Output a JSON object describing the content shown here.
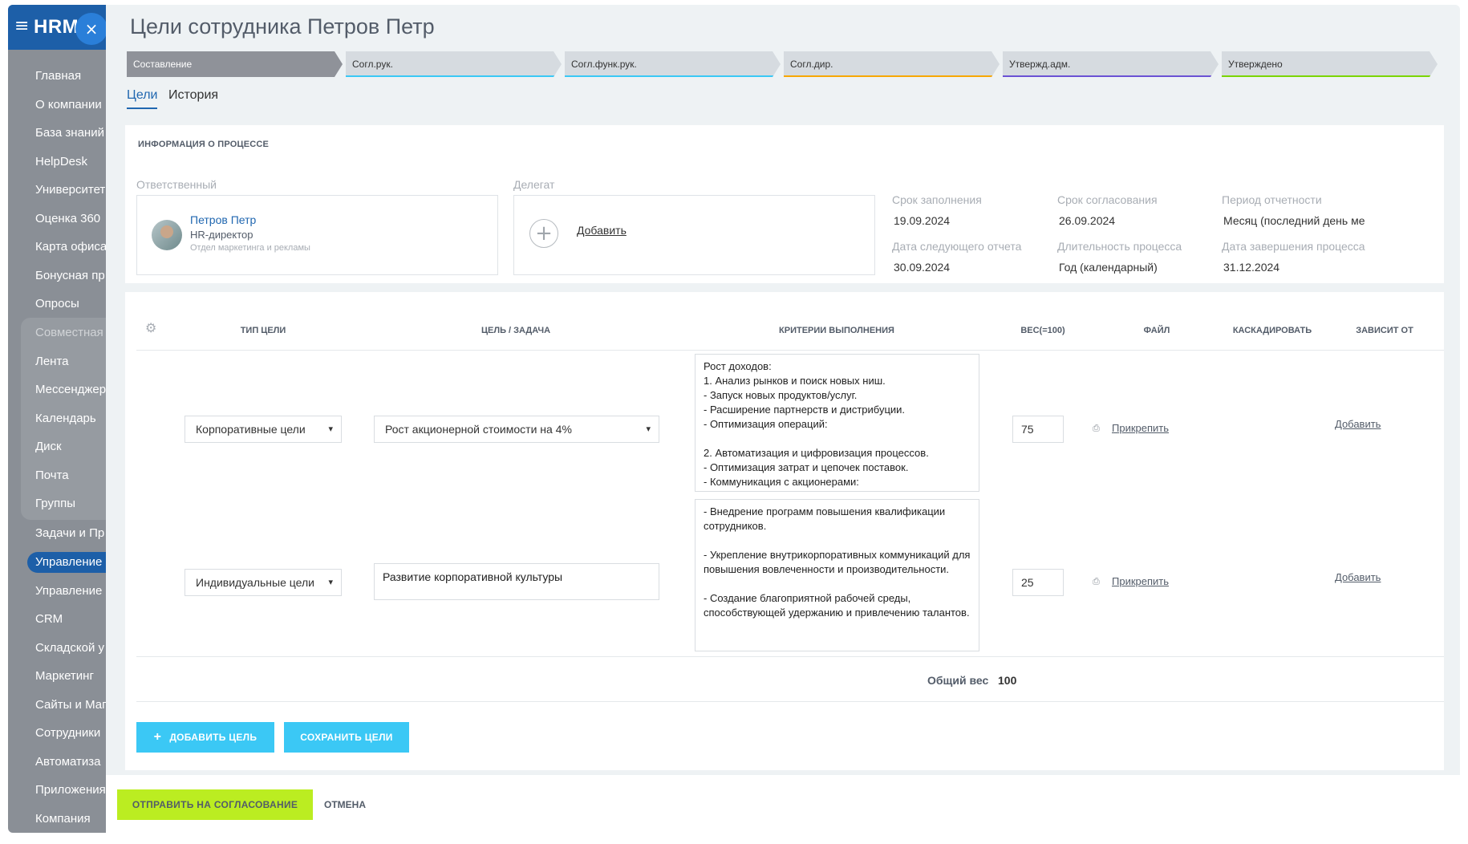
{
  "sidebar": {
    "logo": "HRM",
    "burger_icon": "≡",
    "close_icon": "×",
    "items": [
      "Главная",
      "О компании",
      "База знаний",
      "HelpDesk",
      "Университет",
      "Оценка 360",
      "Карта офиса",
      "Бонусная пр",
      "Опросы",
      "Совместная",
      "Лента",
      "Мессенджер",
      "Календарь",
      "Диск",
      "Почта",
      "Группы",
      "Задачи и Пр",
      "Управление",
      "Управление",
      "CRM",
      "Складской у",
      "Маркетинг",
      "Сайты и Маг",
      "Сотрудники",
      "Автоматиза",
      "Приложения",
      "Компания"
    ]
  },
  "page": {
    "title": "Цели сотрудника Петров Петр"
  },
  "stages": [
    {
      "label": "Составление",
      "color": "#8f9299"
    },
    {
      "label": "Согл.рук.",
      "color": "#3bc8f5"
    },
    {
      "label": "Согл.функ.рук.",
      "color": "#3bc8f5"
    },
    {
      "label": "Согл.дир.",
      "color": "#f7a700"
    },
    {
      "label": "Утвержд.адм.",
      "color": "#6b52d4"
    },
    {
      "label": "Утверждено",
      "color": "#7bd500"
    }
  ],
  "tabs": [
    "Цели",
    "История"
  ],
  "info": {
    "section_title": "ИНФОРМАЦИЯ О ПРОЦЕССЕ",
    "responsible_label": "Ответственный",
    "responsible": {
      "name": "Петров Петр",
      "position": "HR-директор",
      "department": "Отдел маркетинга и рекламы"
    },
    "delegate_label": "Делегат",
    "delegate_add": "Добавить",
    "meta": [
      {
        "label": "Срок заполнения",
        "value": "19.09.2024"
      },
      {
        "label": "Срок согласования",
        "value": "26.09.2024"
      },
      {
        "label": "Период отчетности",
        "value": "Месяц (последний день ме"
      },
      {
        "label": "Дата следующего отчета",
        "value": "30.09.2024"
      },
      {
        "label": "Длительность процесса",
        "value": "Год (календарный)"
      },
      {
        "label": "Дата завершения процесса",
        "value": "31.12.2024"
      }
    ]
  },
  "goals": {
    "settings_icon": "⚙",
    "columns": [
      "ТИП ЦЕЛИ",
      "ЦЕЛЬ / ЗАДАЧА",
      "КРИТЕРИИ ВЫПОЛНЕНИЯ",
      "ВЕС(=100)",
      "ФАЙЛ",
      "КАСКАДИРОВАТЬ",
      "ЗАВИСИТ ОТ"
    ],
    "rows": [
      {
        "type": "Корпоративные цели",
        "goal": "Рост акционерной стоимости на 4%",
        "criteria": "Рост доходов:\n1. Анализ рынков и поиск новых ниш.\n- Запуск новых продуктов/услуг.\n- Расширение партнерств и дистрибуции.\n- Оптимизация операций:\n\n2. Автоматизация и цифровизация процессов.\n- Оптимизация затрат и цепочек поставок.\n- Коммуникация с акционерами:",
        "weight": "75",
        "file": "Прикрепить",
        "depends": "Добавить"
      },
      {
        "type": "Индивидуальные цели",
        "goal": "Развитие корпоративной культуры",
        "criteria": "- Внедрение программ повышения квалификации сотрудников.\n\n- Укрепление внутрикорпоративных коммуникаций для повышения вовлеченности и производительности.\n\n- Создание благоприятной рабочей среды, способствующей удержанию и привлечению талантов.",
        "weight": "25",
        "file": "Прикрепить",
        "depends": "Добавить"
      }
    ],
    "total_label": "Общий вес",
    "total_value": "100",
    "add_goal": "ДОБАВИТЬ ЦЕЛЬ",
    "add_goal_icon": "+",
    "save_goals": "СОХРАНИТЬ ЦЕЛИ"
  },
  "footer": {
    "send": "ОТПРАВИТЬ НА СОГЛАСОВАНИЕ",
    "cancel": "ОТМЕНА"
  }
}
